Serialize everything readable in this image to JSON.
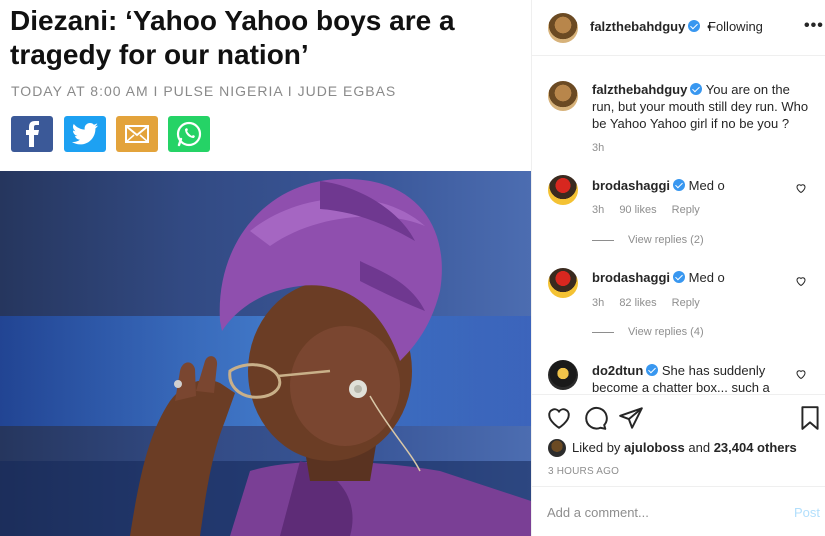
{
  "article": {
    "headline": "Diezani: ‘Yahoo Yahoo boys are a tragedy for our nation’",
    "byline": "TODAY AT 8:00 AM I PULSE NIGERIA I JUDE EGBAS",
    "share_buttons": [
      {
        "icon": "facebook-icon",
        "color": "#3b5998"
      },
      {
        "icon": "twitter-icon",
        "color": "#1da1f2"
      },
      {
        "icon": "email-icon",
        "color": "#e3a33b"
      },
      {
        "icon": "whatsapp-icon",
        "color": "#25d366"
      }
    ]
  },
  "post": {
    "author": "falzthebahdguy",
    "separator": "•",
    "follow_status": "Following",
    "more": "•••"
  },
  "comments": [
    {
      "user": "falzthebahdguy",
      "text": "You are on the run, but your mouth still dey run. Who be Yahoo Yahoo girl if no be you ?",
      "time": "3h"
    },
    {
      "user": "brodashaggi",
      "text": "Med o",
      "time": "3h",
      "likes": "90 likes",
      "reply": "Reply",
      "view_replies": "View replies (2)"
    },
    {
      "user": "brodashaggi",
      "text": "Med o",
      "time": "3h",
      "likes": "82 likes",
      "reply": "Reply",
      "view_replies": "View replies (4)"
    },
    {
      "user": "do2dtun",
      "text": "She has suddenly become a chatter box... such a"
    }
  ],
  "actions": {
    "liked_prefix": "Liked by",
    "liked_user": "ajuloboss",
    "liked_and": "and",
    "liked_others": "23,404 others",
    "posted_ago": "3 HOURS AGO"
  },
  "add_comment": {
    "placeholder": "Add a comment...",
    "post_label": "Post"
  },
  "colors": {
    "verified": "#3897f0",
    "muted": "#8e8e8e",
    "post_disabled": "#b2dffc"
  }
}
